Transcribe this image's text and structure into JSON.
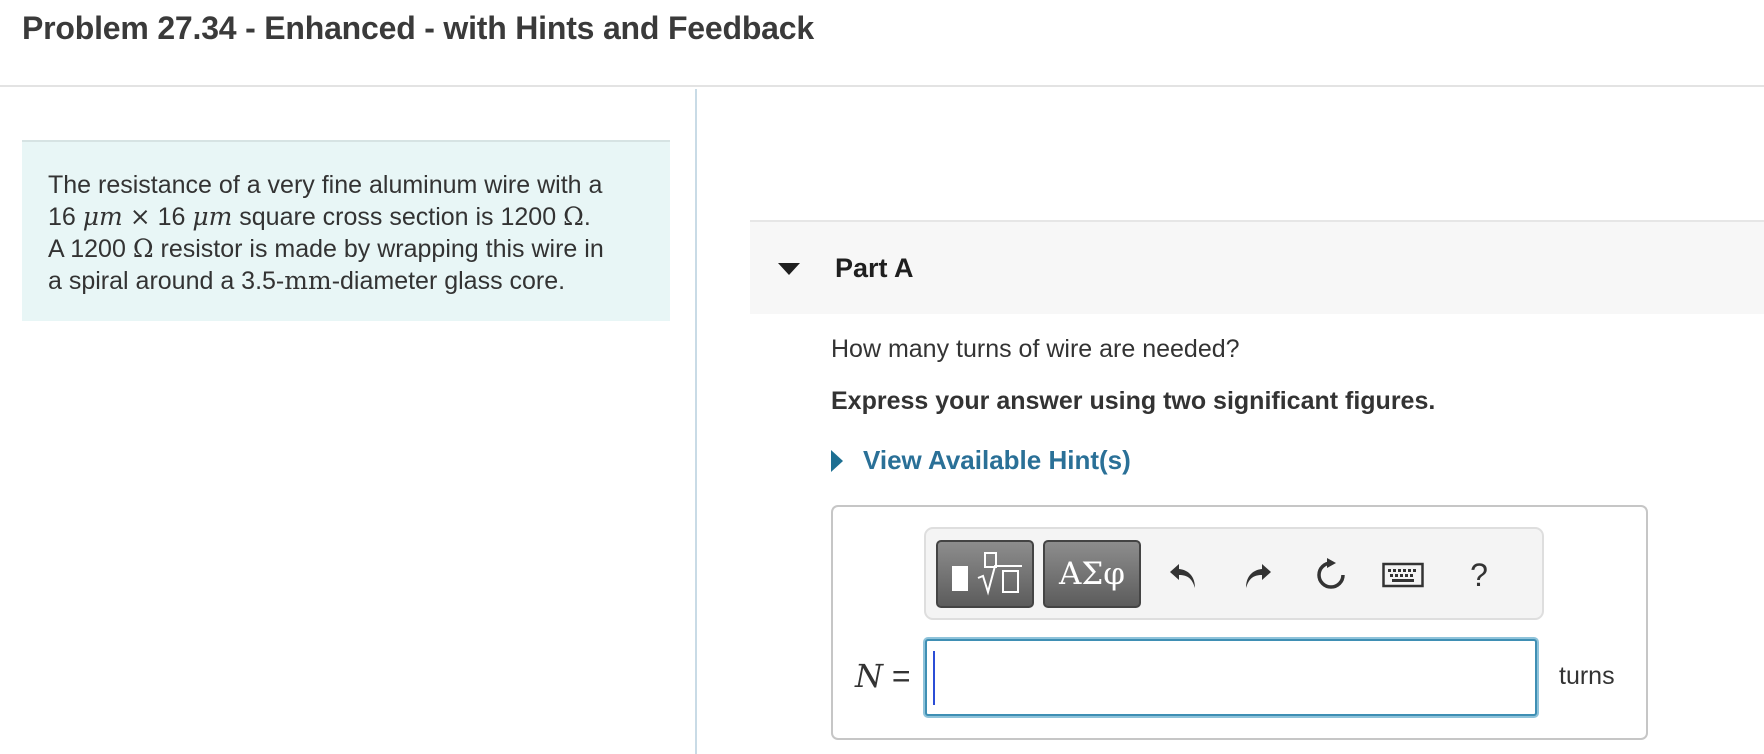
{
  "page": {
    "title": "Problem 27.34 - Enhanced - with Hints and Feedback"
  },
  "problem": {
    "line1": "The resistance of a very fine aluminum wire with a",
    "line2_num1": "16",
    "line2_unit1": "μm",
    "line2_times": "×",
    "line2_num2": "16",
    "line2_unit2": "μm",
    "line2_text": "square cross section is 1200",
    "line2_ohm": "Ω",
    "line2_end": ".",
    "line3_start": "A 1200",
    "line3_ohm": "Ω",
    "line3_text": "resistor is made by wrapping this wire in",
    "line4_start": "a spiral around a 3.5-",
    "line4_unit": "mm",
    "line4_end": "-diameter glass core."
  },
  "part": {
    "label": "Part A",
    "question": "How many turns of wire are needed?",
    "instruction": "Express your answer using two significant figures.",
    "hint_link": "View Available Hint(s)"
  },
  "toolbar": {
    "greek_label": "ΑΣφ",
    "help_label": "?"
  },
  "answer": {
    "variable": "N",
    "equals": "=",
    "value": "",
    "unit": "turns"
  },
  "colors": {
    "problem_bg": "#e8f6f6",
    "link": "#2a7097",
    "input_border": "#3f8fb4"
  },
  "icons": [
    "templates-icon",
    "undo-icon",
    "redo-icon",
    "reset-icon",
    "keyboard-icon"
  ]
}
